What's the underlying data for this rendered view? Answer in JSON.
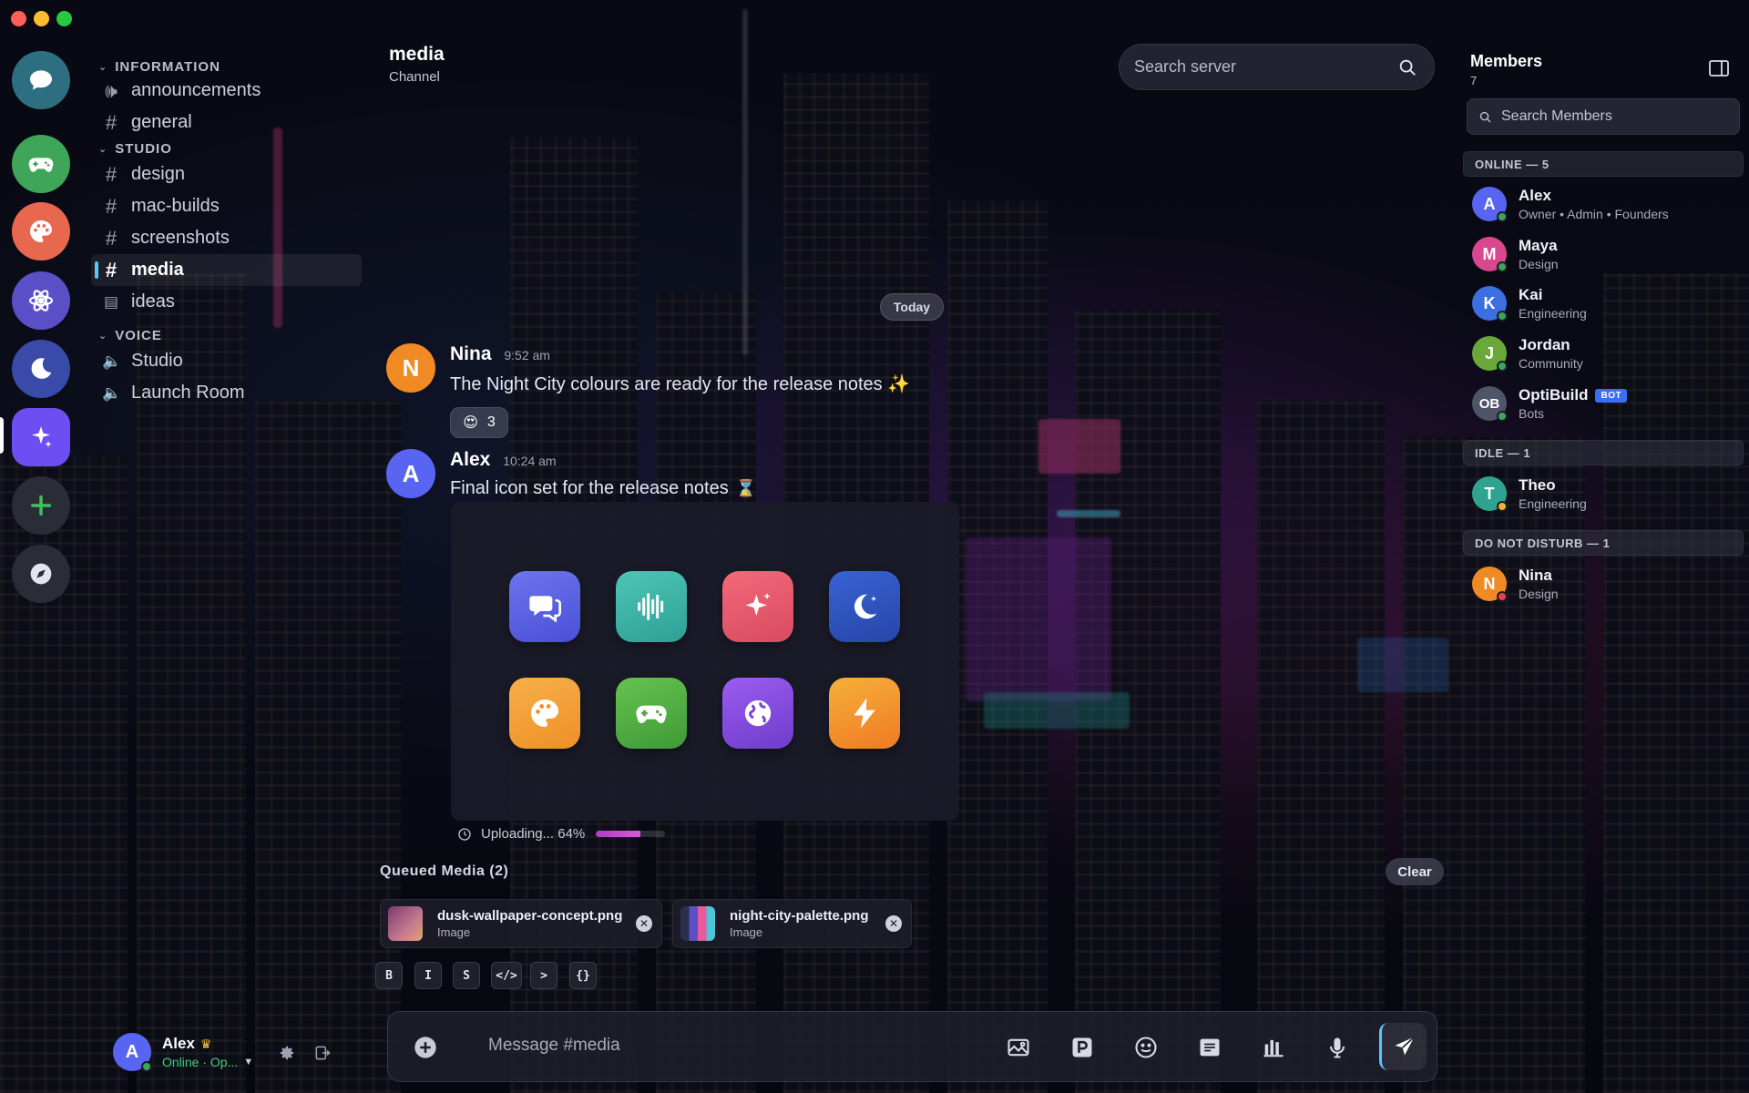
{
  "colors": {
    "accent": "#57c7ff",
    "online": "#3ba55d",
    "idle": "#f0b232",
    "dnd": "#ed4245",
    "progress": "#b13bc5"
  },
  "server_rail": [
    {
      "name": "Direct Messages",
      "icon": "chat-bubble-icon",
      "color": "#2d7f91"
    },
    {
      "name": "Gaming",
      "icon": "gamepad-icon",
      "color": "#3fa559"
    },
    {
      "name": "Art",
      "icon": "palette-icon",
      "color": "#e8674f"
    },
    {
      "name": "React",
      "icon": "atom-icon",
      "color": "#5b4fc8"
    },
    {
      "name": "Night",
      "icon": "moon-icon",
      "color": "#3a4aa8"
    },
    {
      "name": "Sparkle",
      "icon": "sparkle-icon",
      "color": "#6c4ff2",
      "selected": true
    },
    {
      "name": "Add Server",
      "icon": "plus-icon",
      "color": "#2e3038"
    },
    {
      "name": "Explore",
      "icon": "compass-icon",
      "color": "#2e3038"
    }
  ],
  "sidebar": {
    "categories": [
      {
        "label": "INFORMATION",
        "channels": [
          {
            "label": "announcements",
            "icon": "megaphone-icon"
          },
          {
            "label": "general",
            "icon": "hash-icon"
          }
        ]
      },
      {
        "label": "STUDIO",
        "channels": [
          {
            "label": "design",
            "icon": "hash-icon"
          },
          {
            "label": "mac-builds",
            "icon": "hash-icon"
          },
          {
            "label": "screenshots",
            "icon": "hash-icon"
          },
          {
            "label": "media",
            "icon": "hash-icon",
            "active": true
          },
          {
            "label": "ideas",
            "icon": "forum-icon"
          }
        ]
      },
      {
        "label": "VOICE",
        "channels": [
          {
            "label": "Studio",
            "icon": "speaker-icon"
          },
          {
            "label": "Launch Room",
            "icon": "speaker-icon"
          }
        ]
      }
    ]
  },
  "user_panel": {
    "name": "Alex",
    "initial": "A",
    "status": "Online · Op..."
  },
  "header": {
    "title": "media",
    "subtitle": "Channel",
    "search_placeholder": "Search server"
  },
  "messages": {
    "divider": "Today",
    "items": [
      {
        "author": "Nina",
        "initial": "N",
        "time": "9:52 am",
        "text": "The Night City colours are ready for the release notes ✨",
        "reaction_emoji": "😍",
        "reaction_count": "3"
      },
      {
        "author": "Alex",
        "initial": "A",
        "time": "10:24 am",
        "text": "Final icon set for the release notes"
      }
    ],
    "attachment_icons": [
      {
        "icon": "chat-bubbles-icon",
        "color": "#5a63e6"
      },
      {
        "icon": "waveform-icon",
        "color": "#3fb5a8"
      },
      {
        "icon": "sparkle-icon",
        "color": "#e85a6b"
      },
      {
        "icon": "moon-icon",
        "color": "#2f57c8"
      },
      {
        "icon": "palette-icon",
        "color": "#f3a43a"
      },
      {
        "icon": "gamepad-icon",
        "color": "#52b446"
      },
      {
        "icon": "globe-icon",
        "color": "#8a4fe0"
      },
      {
        "icon": "bolt-icon",
        "color": "#f39a2d"
      }
    ],
    "upload_text": "Uploading... 64%",
    "upload_progress": 0.64
  },
  "queue": {
    "title": "Queued Media (2)",
    "clear_label": "Clear",
    "items": [
      {
        "name": "dusk-wallpaper-concept.png",
        "type": "Image"
      },
      {
        "name": "night-city-palette.png",
        "type": "Image"
      }
    ]
  },
  "format_toolbar": [
    "B",
    "I",
    "S",
    "</>",
    ">",
    "{}"
  ],
  "composer": {
    "placeholder": "Message #media"
  },
  "members": {
    "title": "Members",
    "count": "7",
    "search_placeholder": "Search Members",
    "groups": [
      {
        "label": "ONLINE — 5",
        "members": [
          {
            "name": "Alex",
            "initial": "A",
            "role": "Owner • Admin • Founders",
            "color": "#5865f2",
            "status": "online"
          },
          {
            "name": "Maya",
            "initial": "M",
            "role": "Design",
            "color": "#d9478f",
            "status": "online"
          },
          {
            "name": "Kai",
            "initial": "K",
            "role": "Engineering",
            "color": "#3b6fe0",
            "status": "online"
          },
          {
            "name": "Jordan",
            "initial": "J",
            "role": "Community",
            "color": "#6aa83a",
            "status": "online"
          },
          {
            "name": "OptiBuild",
            "initial": "OB",
            "role": "Bots",
            "color": "#4f5466",
            "status": "online",
            "badge": "BOT"
          }
        ]
      },
      {
        "label": "IDLE — 1",
        "members": [
          {
            "name": "Theo",
            "initial": "T",
            "role": "Engineering",
            "color": "#2fa38f",
            "status": "idle"
          }
        ]
      },
      {
        "label": "DO NOT DISTURB — 1",
        "members": [
          {
            "name": "Nina",
            "initial": "N",
            "role": "Design",
            "color": "#f08a24",
            "status": "dnd"
          }
        ]
      }
    ]
  }
}
